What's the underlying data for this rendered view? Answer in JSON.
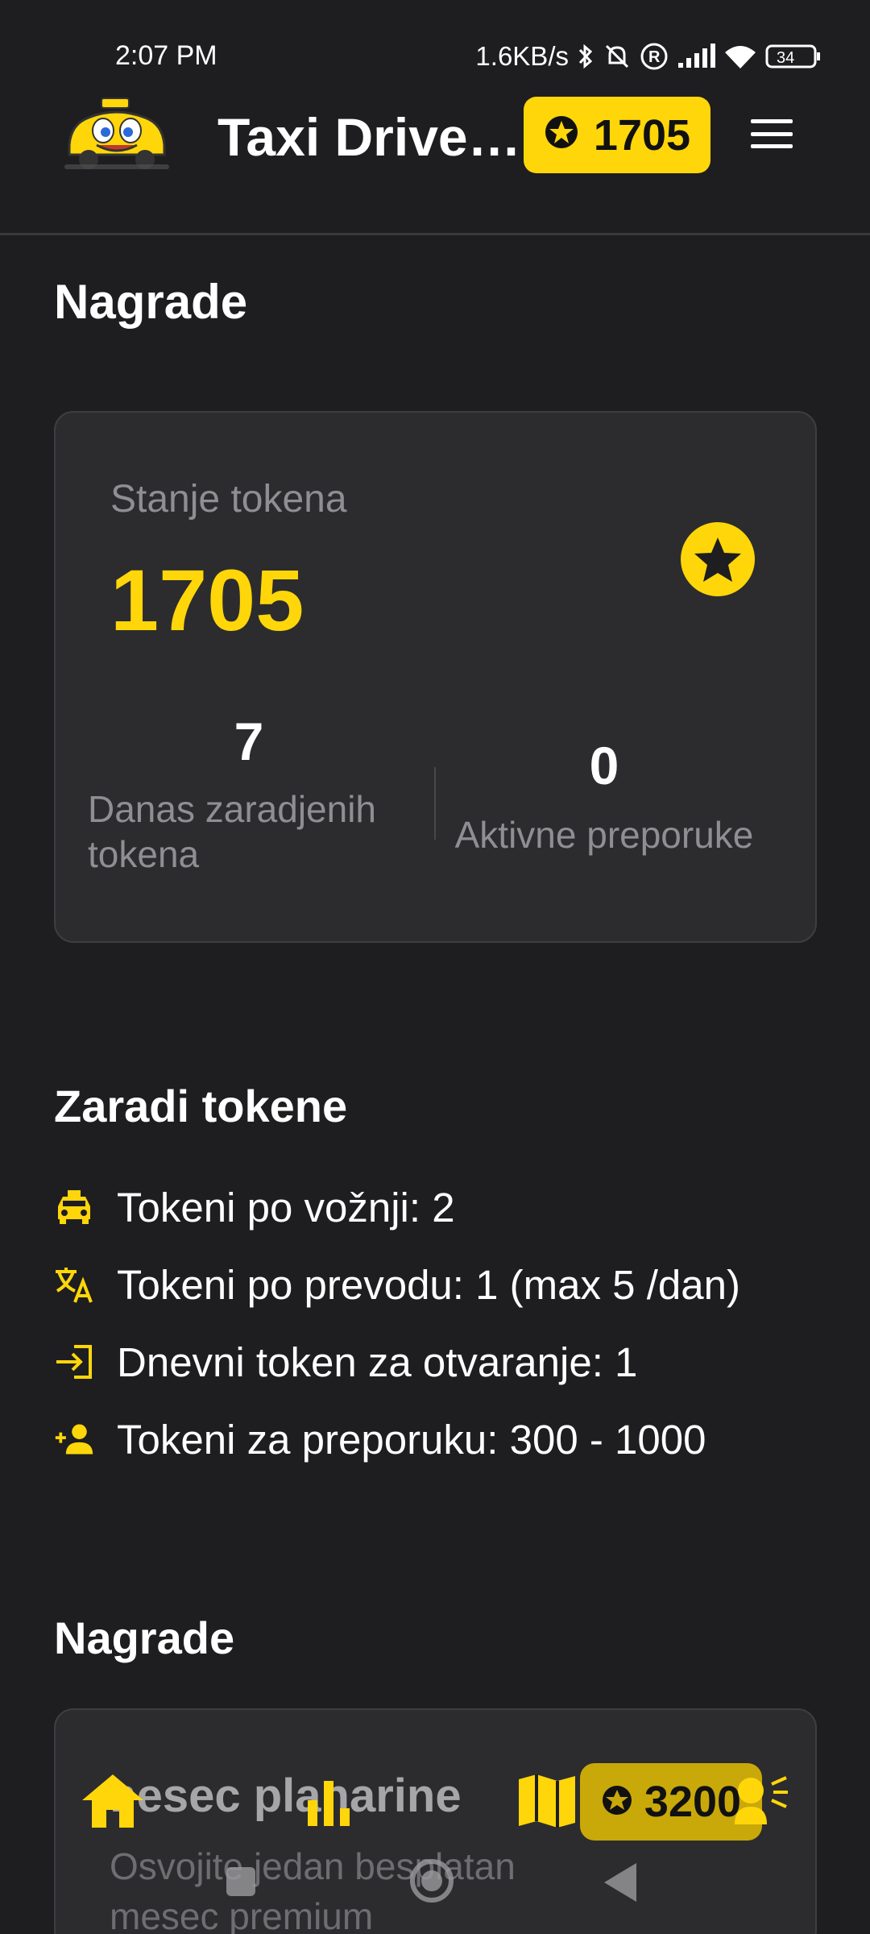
{
  "status_bar": {
    "time": "2:07 PM",
    "network_speed": "1.6KB/s",
    "battery": "34",
    "icons": [
      "bluetooth-icon",
      "bell-off-icon",
      "registered-icon",
      "signal-icon",
      "wifi-icon",
      "battery-icon"
    ]
  },
  "header": {
    "title": "Taxi Driver...",
    "token_balance": "1705",
    "logo_icon": "taxi-mascot-logo",
    "menu_icon": "menu-icon"
  },
  "page": {
    "title": "Nagrade"
  },
  "balance_card": {
    "label": "Stanje tokena",
    "value": "1705",
    "icon": "star-circle-icon",
    "stats": [
      {
        "value": "7",
        "label_line1": "Danas zaradjenih",
        "label_line2": "tokena"
      },
      {
        "value": "0",
        "label_line1": "Aktivne preporuke"
      }
    ]
  },
  "earn": {
    "title": "Zaradi tokene",
    "items": [
      {
        "icon": "taxi-icon",
        "text": "Tokeni po vožnji: 2"
      },
      {
        "icon": "translate-icon",
        "text": "Tokeni po prevodu: 1 (max 5 /dan)"
      },
      {
        "icon": "login-icon",
        "text": "Dnevni token za otvaranje: 1"
      },
      {
        "icon": "person-add-icon",
        "text": "Tokeni za preporuku: 300 - 1000"
      }
    ]
  },
  "rewards": {
    "title": "Nagrade",
    "items": [
      {
        "title": "mesec planarine",
        "cost": "3200",
        "desc_line1": "Osvojite jedan besplatan",
        "desc_line2": "mesec premium"
      }
    ]
  },
  "bottom_nav": {
    "icons": [
      "home-icon",
      "stats-icon",
      "map-icon",
      "speak-icon"
    ]
  },
  "colors": {
    "background": "#1e1e20",
    "card": "#2c2c2e",
    "accent": "#ffd60a",
    "muted_text": "#8e8e93"
  }
}
